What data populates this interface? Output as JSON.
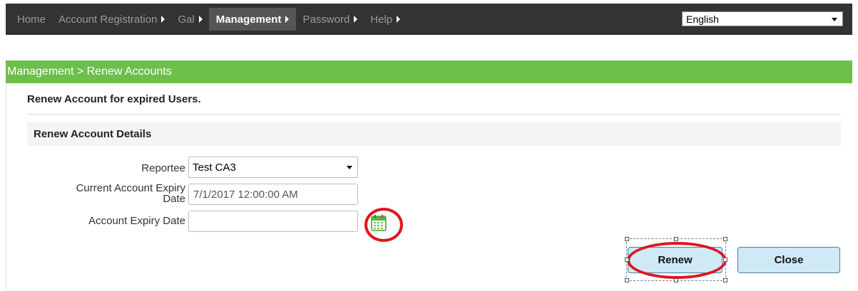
{
  "nav": {
    "items": [
      {
        "label": "Home",
        "has_arrow": false,
        "active": false
      },
      {
        "label": "Account Registration",
        "has_arrow": true,
        "active": false
      },
      {
        "label": "Gal",
        "has_arrow": true,
        "active": false
      },
      {
        "label": "Management",
        "has_arrow": true,
        "active": true
      },
      {
        "label": "Password",
        "has_arrow": true,
        "active": false
      },
      {
        "label": "Help",
        "has_arrow": true,
        "active": false
      }
    ],
    "language": "English"
  },
  "breadcrumb": "Management > Renew Accounts",
  "intro_text": "Renew Account for expired Users.",
  "details_title": "Renew Account Details",
  "form": {
    "reportee_label": "Reportee",
    "reportee_value": "Test CA3",
    "current_expiry_label_line1": "Current Account Expiry",
    "current_expiry_label_line2": "Date",
    "current_expiry_value": "7/1/2017 12:00:00 AM",
    "expiry_label": "Account Expiry Date",
    "expiry_value": ""
  },
  "buttons": {
    "renew": "Renew",
    "close": "Close"
  },
  "icons": {
    "calendar": "calendar-icon",
    "nav_arrow": "triangle-right-icon",
    "dropdown": "caret-down-icon"
  },
  "colors": {
    "nav_bg": "#333333",
    "section_bar": "#6dbf4b",
    "button_bg": "#cfe9f6",
    "annotation_red": "#e0141e"
  }
}
